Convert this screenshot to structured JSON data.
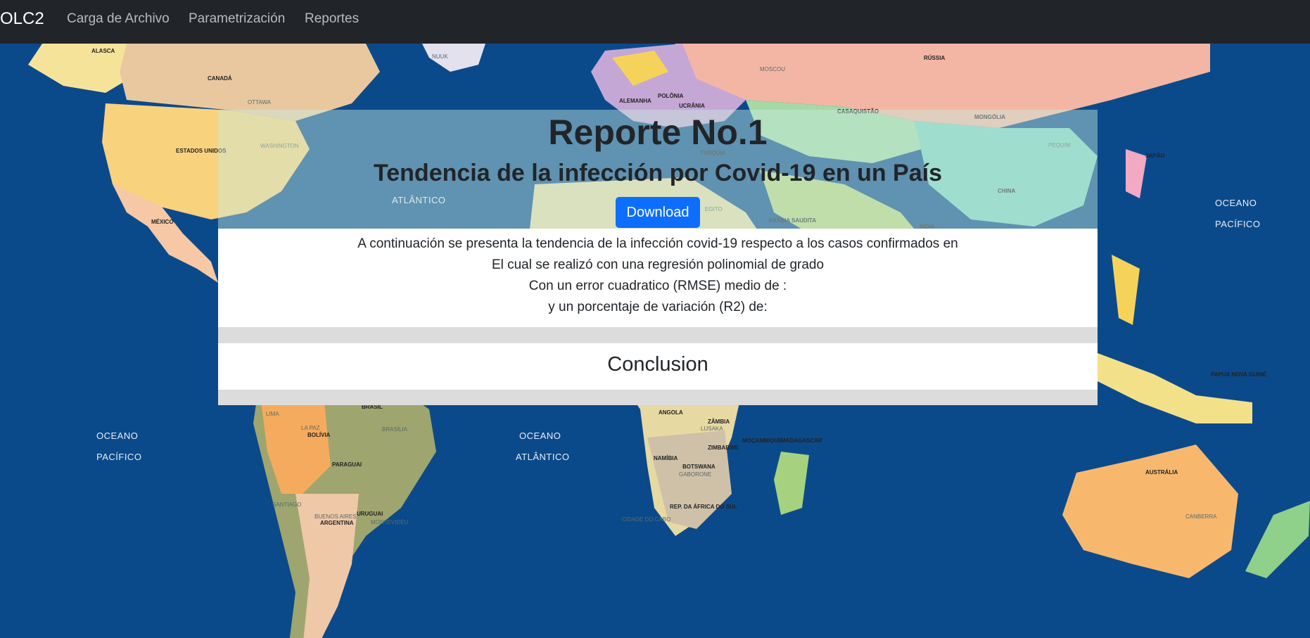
{
  "navbar": {
    "brand": "OLC2",
    "links": [
      "Carga de Archivo",
      "Parametrización",
      "Reportes"
    ]
  },
  "report": {
    "title": "Reporte No.1",
    "subtitle": "Tendencia de la infección por Covid-19 en un País",
    "download_label": "Download",
    "lines": [
      "A continuación se presenta la tendencia de la infección covid-19 respecto a los casos confirmados en",
      "El cual se realizó con una regresión polinomial de grado",
      "Con un error cuadratico (RMSE) medio de :",
      "y un porcentaje de variación (R2) de:"
    ],
    "conclusion_title": "Conclusion"
  },
  "map": {
    "labels": [
      "ALASCA",
      "CANADÁ",
      "OTTAWA",
      "ESTADOS UNIDOS",
      "WASHINGTON",
      "MÉXICO",
      "RÚSSIA",
      "MOSCOU",
      "CASAQUISTÃO",
      "MONGÓLIA",
      "CHINA",
      "PEQUIM",
      "TURQUIA",
      "ATLÂNTICO",
      "EGITO",
      "ARÁBIA SAUDITA",
      "ÍNDIA",
      "BRASIL",
      "BRASÍLIA",
      "BOLÍVIA",
      "LA PAZ",
      "PARAGUAI",
      "URUGUAI",
      "ARGENTINA",
      "BUENOS AIRES",
      "SANTIAGO",
      "ANGOLA",
      "ZÂMBIA",
      "ZIMBABWE",
      "NAMÍBIA",
      "BOTSWANA",
      "MOÇAMBIQUE",
      "MADAGASCAR",
      "REP. DA ÁFRICA DO SUL",
      "CIDADE DO CABO",
      "AUSTRÁLIA",
      "CANBERRA",
      "PAPUA NOVA GUINÉ",
      "JAPÃO",
      "UCRÂNIA",
      "POLÔNIA",
      "ALEMANHA",
      "NUUK",
      "LIMA",
      "MONTEVIDÉU",
      "LUSAKA",
      "GABORONE"
    ],
    "oceans": [
      "OCEANO",
      "PACÍFICO",
      "OCEANO",
      "PACÍFICO",
      "OCEANO",
      "ATLÂNTICO"
    ]
  },
  "colors": {
    "navbar": "#212529",
    "ocean": "#0b4a8a",
    "primary_button": "#0d6efd"
  }
}
